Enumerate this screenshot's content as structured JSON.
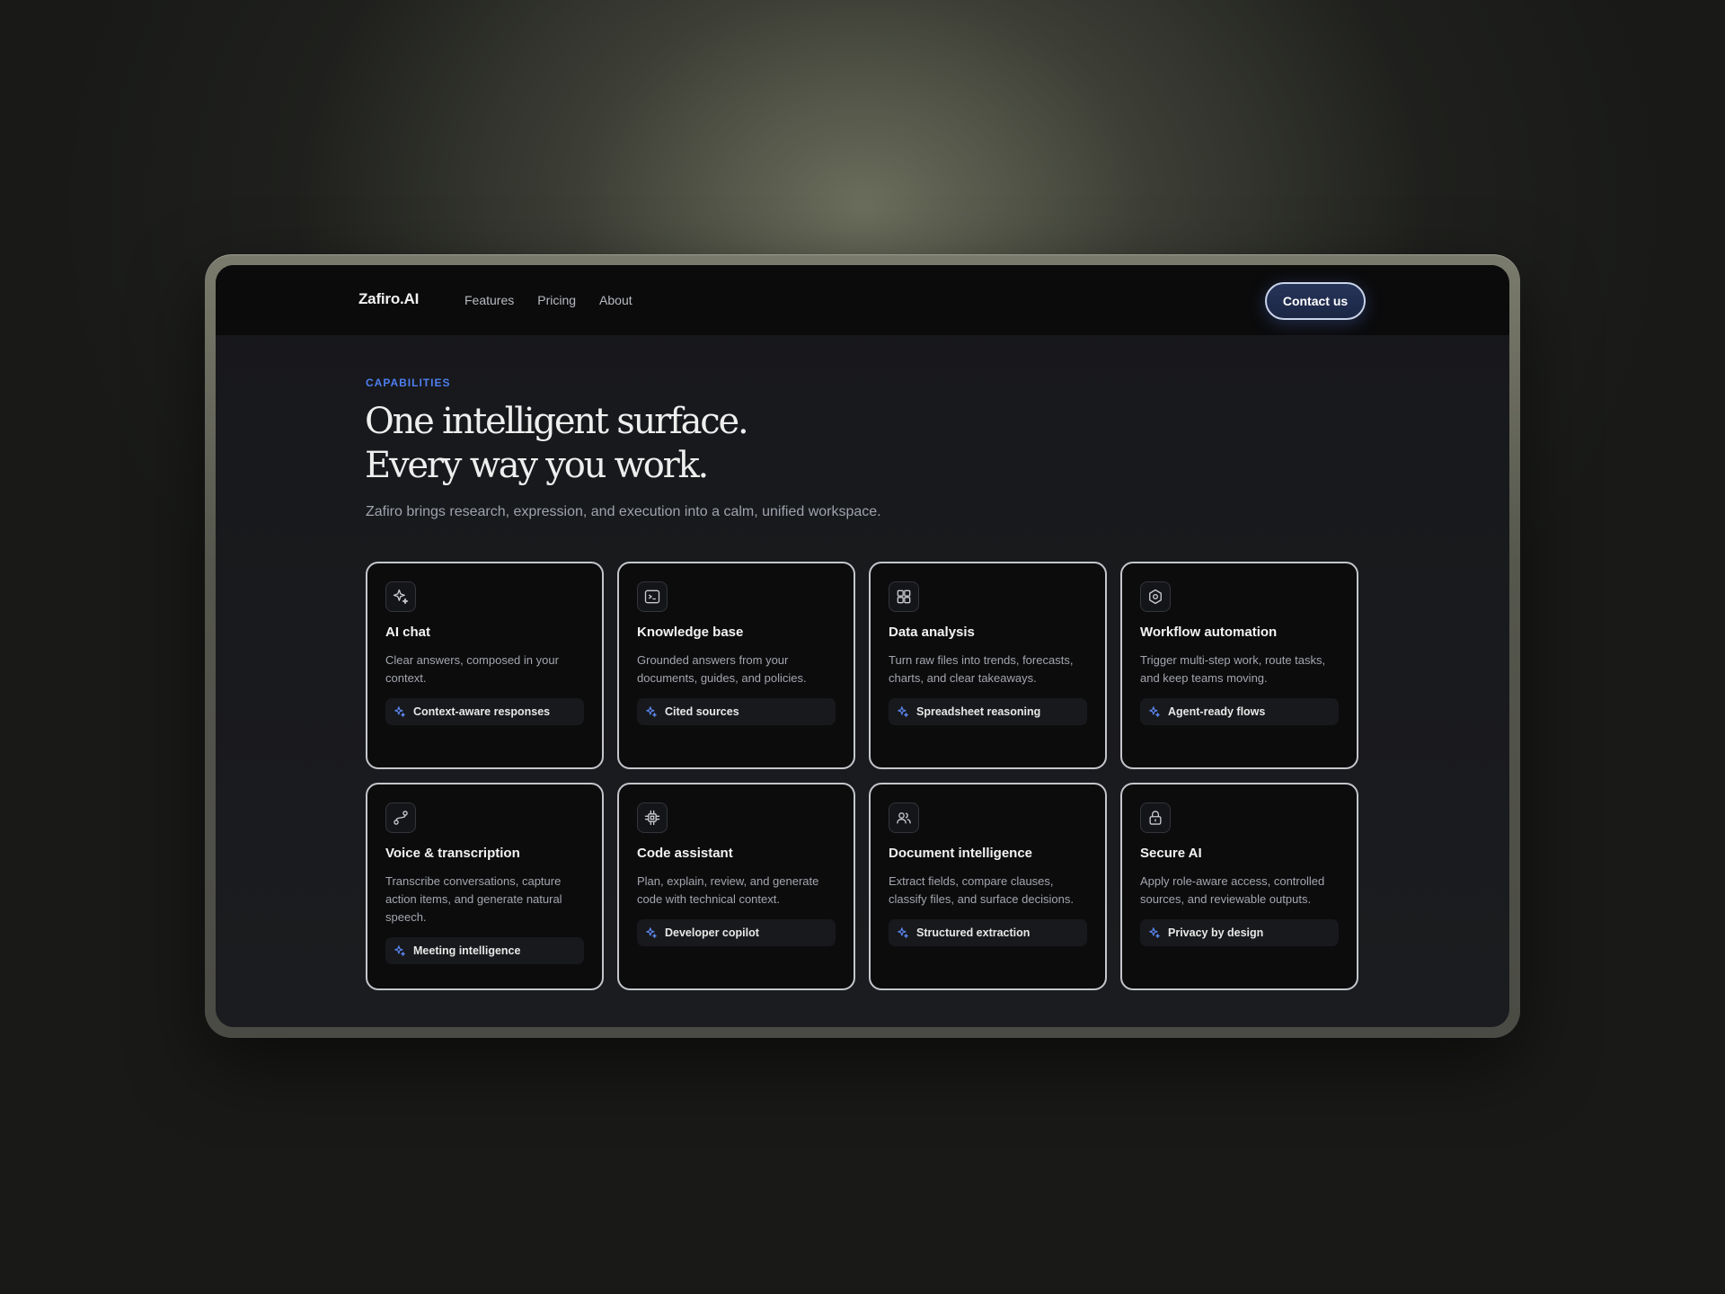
{
  "nav": {
    "brand": "Zafiro.AI",
    "links": [
      "Features",
      "Pricing",
      "About"
    ],
    "cta": "Contact us"
  },
  "hero": {
    "eyebrow": "CAPABILITIES",
    "headline_line1": "One intelligent surface.",
    "headline_line2": "Every way you work.",
    "subtitle": "Zafiro brings research, expression, and execution into a calm, unified workspace."
  },
  "cards": [
    {
      "icon": "sparkle-icon",
      "title": "AI chat",
      "description": "Clear answers, composed in your context.",
      "tag": "Context-aware responses"
    },
    {
      "icon": "terminal-icon",
      "title": "Knowledge base",
      "description": "Grounded answers from your documents, guides, and policies.",
      "tag": "Cited sources"
    },
    {
      "icon": "grid-icon",
      "title": "Data analysis",
      "description": "Turn raw files into trends, forecasts, charts, and clear takeaways.",
      "tag": "Spreadsheet reasoning"
    },
    {
      "icon": "hexagon-icon",
      "title": "Workflow automation",
      "description": "Trigger multi-step work, route tasks, and keep teams moving.",
      "tag": "Agent-ready flows"
    },
    {
      "icon": "route-icon",
      "title": "Voice & transcription",
      "description": "Transcribe conversations, capture action items, and generate natural speech.",
      "tag": "Meeting intelligence"
    },
    {
      "icon": "cpu-icon",
      "title": "Code assistant",
      "description": "Plan, explain, review, and generate code with technical context.",
      "tag": "Developer copilot"
    },
    {
      "icon": "users-icon",
      "title": "Document intelligence",
      "description": "Extract fields, compare clauses, classify files, and surface decisions.",
      "tag": "Structured extraction"
    },
    {
      "icon": "lock-icon",
      "title": "Secure AI",
      "description": "Apply role-aware access, controlled sources, and reviewable outputs.",
      "tag": "Privacy by design"
    }
  ],
  "colors": {
    "accent": "#4f7ef0",
    "card_border": "#c4c6cc",
    "card_bg": "#0c0c0d"
  }
}
